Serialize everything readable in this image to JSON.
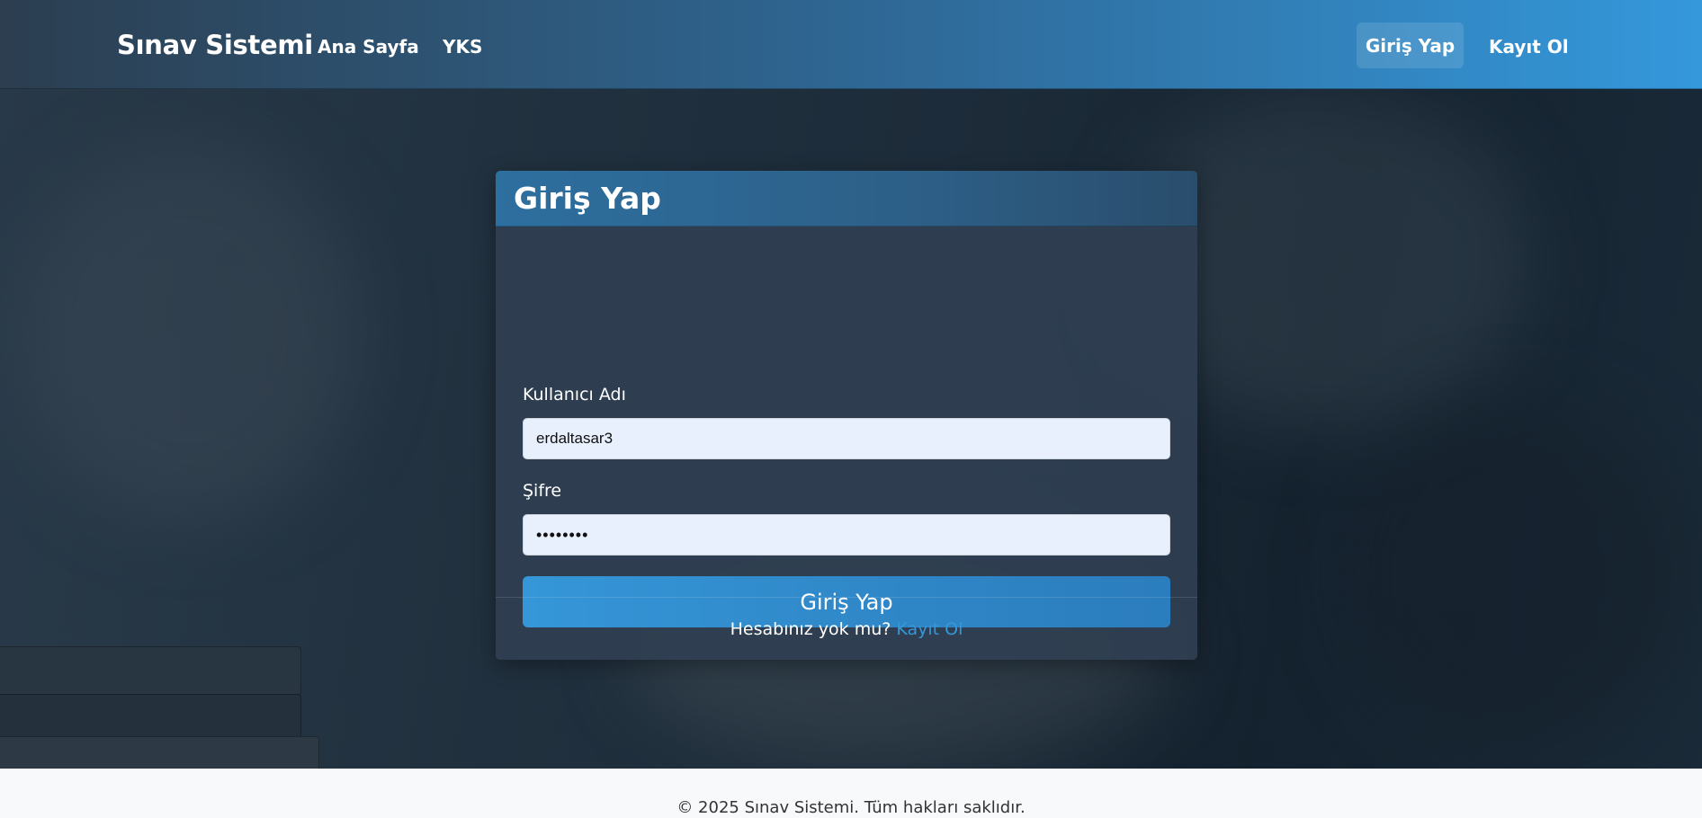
{
  "navbar": {
    "brand": "Sınav Sistemi",
    "links": [
      "Ana Sayfa",
      "YKS"
    ],
    "login_label": "Giriş Yap",
    "register_label": "Kayıt Ol"
  },
  "login_card": {
    "title": "Giriş Yap",
    "username_label": "Kullanıcı Adı",
    "username_value": "erdaltasar3",
    "password_label": "Şifre",
    "password_value": "••••••••",
    "submit_label": "Giriş Yap",
    "footer_text": "Hesabınız yok mu?",
    "footer_link": "Kayıt Ol"
  },
  "page_footer": {
    "copyright": "© 2025 Sınav Sistemi. Tüm hakları saklıdır."
  },
  "colors": {
    "accent": "#3498db",
    "navbar_start": "#2c3e50",
    "card_bg": "#2f4052",
    "input_bg": "#e8f0fe"
  }
}
